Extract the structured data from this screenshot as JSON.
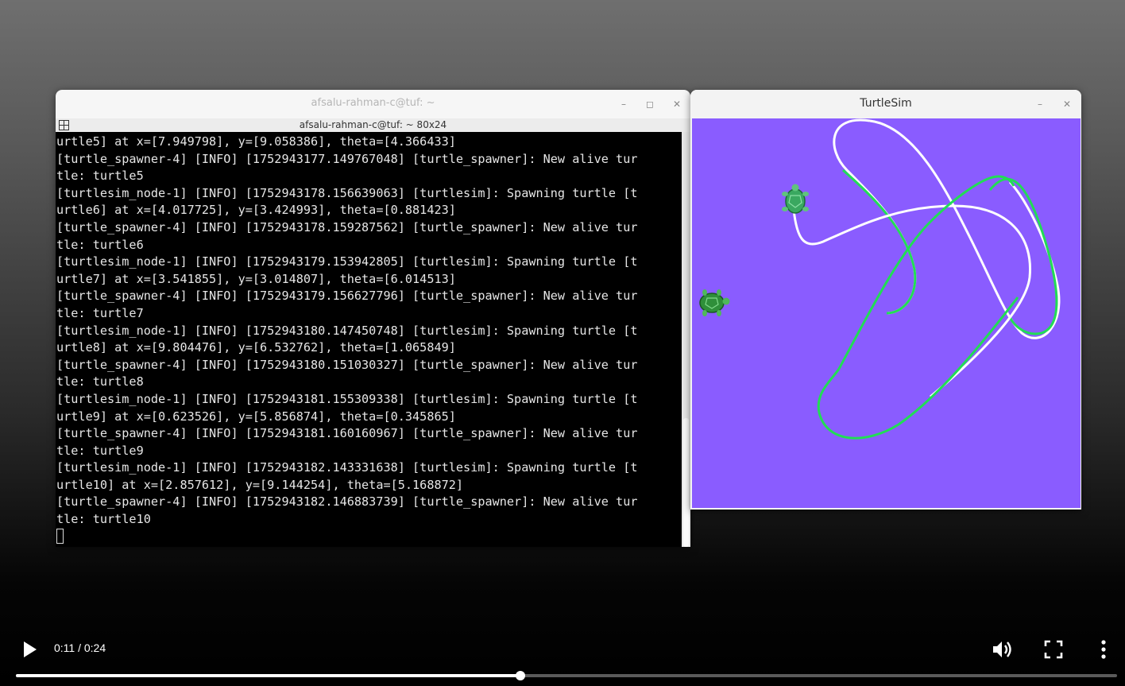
{
  "terminal": {
    "title": "afsalu-rahman-c@tuf: ~",
    "subtitle": "afsalu-rahman-c@tuf: ~ 80x24",
    "lines": [
      "urtle5] at x=[7.949798], y=[9.058386], theta=[4.366433]",
      "[turtle_spawner-4] [INFO] [1752943177.149767048] [turtle_spawner]: New alive tur",
      "tle: turtle5",
      "[turtlesim_node-1] [INFO] [1752943178.156639063] [turtlesim]: Spawning turtle [t",
      "urtle6] at x=[4.017725], y=[3.424993], theta=[0.881423]",
      "[turtle_spawner-4] [INFO] [1752943178.159287562] [turtle_spawner]: New alive tur",
      "tle: turtle6",
      "[turtlesim_node-1] [INFO] [1752943179.153942805] [turtlesim]: Spawning turtle [t",
      "urtle7] at x=[3.541855], y=[3.014807], theta=[6.014513]",
      "[turtle_spawner-4] [INFO] [1752943179.156627796] [turtle_spawner]: New alive tur",
      "tle: turtle7",
      "[turtlesim_node-1] [INFO] [1752943180.147450748] [turtlesim]: Spawning turtle [t",
      "urtle8] at x=[9.804476], y=[6.532762], theta=[1.065849]",
      "[turtle_spawner-4] [INFO] [1752943180.151030327] [turtle_spawner]: New alive tur",
      "tle: turtle8",
      "[turtlesim_node-1] [INFO] [1752943181.155309338] [turtlesim]: Spawning turtle [t",
      "urtle9] at x=[0.623526], y=[5.856874], theta=[0.345865]",
      "[turtle_spawner-4] [INFO] [1752943181.160160967] [turtle_spawner]: New alive tur",
      "tle: turtle9",
      "[turtlesim_node-1] [INFO] [1752943182.143331638] [turtlesim]: Spawning turtle [t",
      "urtle10] at x=[2.857612], y=[9.144254], theta=[5.168872]",
      "[turtle_spawner-4] [INFO] [1752943182.146883739] [turtle_spawner]: New alive tur",
      "tle: turtle10"
    ]
  },
  "turtlesim": {
    "title": "TurtleSim",
    "background_color": "#8a5cff",
    "trail_colors": [
      "#ffffff",
      "#22dd55"
    ]
  },
  "player": {
    "time": "0:11 / 0:24",
    "progress": 0.458,
    "icons": [
      "play-icon",
      "volume-icon",
      "fullscreen-icon",
      "more-vert-icon"
    ]
  },
  "colors": {
    "terminal_bg": "#000000",
    "terminal_fg": "#e6e6e6"
  }
}
